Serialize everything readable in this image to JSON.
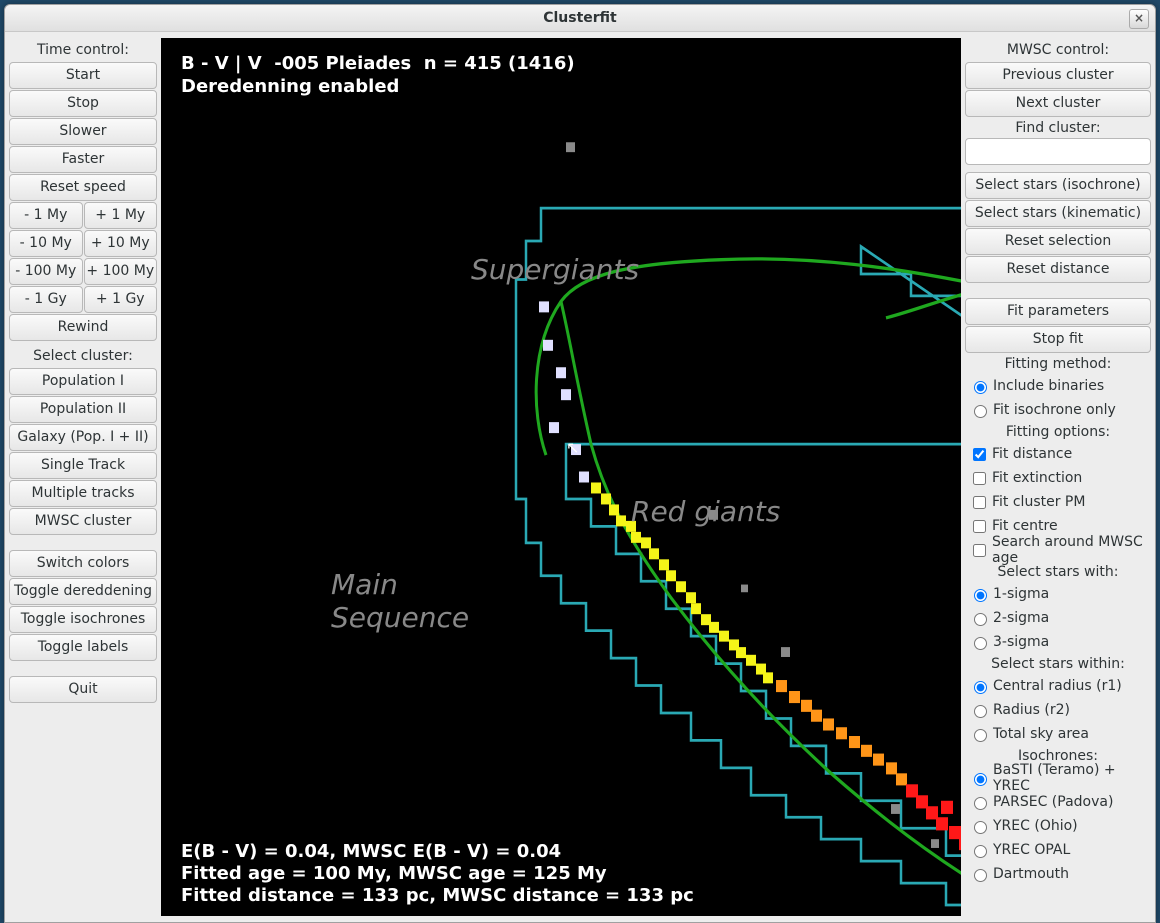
{
  "window": {
    "title": "Clusterfit"
  },
  "left": {
    "time_control_label": "Time control:",
    "start": "Start",
    "stop": "Stop",
    "slower": "Slower",
    "faster": "Faster",
    "reset_speed": "Reset speed",
    "minus_1my": "- 1 My",
    "plus_1my": "+ 1 My",
    "minus_10my": "- 10 My",
    "plus_10my": "+ 10 My",
    "minus_100my": "- 100 My",
    "plus_100my": "+ 100 My",
    "minus_1gy": "- 1 Gy",
    "plus_1gy": "+ 1 Gy",
    "rewind": "Rewind",
    "select_cluster_label": "Select cluster:",
    "pop1": "Population I",
    "pop2": "Population II",
    "galaxy": "Galaxy (Pop. I + II)",
    "single_track": "Single Track",
    "multiple_tracks": "Multiple tracks",
    "mwsc_cluster": "MWSC cluster",
    "switch_colors": "Switch colors",
    "toggle_dered": "Toggle dereddening",
    "toggle_iso": "Toggle isochrones",
    "toggle_labels": "Toggle labels",
    "quit": "Quit"
  },
  "plot": {
    "header_line1": "B - V | V  -005 Pleiades  n = 415 (1416)",
    "header_line2": "Deredenning enabled",
    "label_supergiants": "Supergiants",
    "label_redgiants": "Red giants",
    "label_mainseq": "Main\nSequence",
    "footer_line1": "E(B - V) = 0.04, MWSC E(B - V) = 0.04",
    "footer_line2": "Fitted age = 100 My, MWSC age = 125 My",
    "footer_line3": "Fitted distance = 133 pc, MWSC distance = 133 pc"
  },
  "right": {
    "mwsc_control_label": "MWSC control:",
    "prev_cluster": "Previous cluster",
    "next_cluster": "Next cluster",
    "find_cluster_label": "Find cluster:",
    "find_cluster_value": "",
    "select_iso": "Select stars (isochrone)",
    "select_kin": "Select stars (kinematic)",
    "reset_selection": "Reset selection",
    "reset_distance": "Reset distance",
    "fit_params": "Fit parameters",
    "stop_fit": "Stop fit",
    "fitting_method_label": "Fitting method:",
    "opt_include_binaries": "Include binaries",
    "opt_fit_iso_only": "Fit isochrone only",
    "fitting_options_label": "Fitting options:",
    "opt_fit_distance": "Fit distance",
    "opt_fit_extinction": "Fit extinction",
    "opt_fit_pm": "Fit cluster PM",
    "opt_fit_centre": "Fit centre",
    "opt_search_mwsc_age": "Search around MWSC age",
    "select_stars_with_label": "Select stars with:",
    "sigma1": "1-sigma",
    "sigma2": "2-sigma",
    "sigma3": "3-sigma",
    "select_stars_within_label": "Select stars within:",
    "central_radius": "Central radius (r1)",
    "radius": "Radius (r2)",
    "total_sky": "Total sky area",
    "isochrones_label": "Isochrones:",
    "iso_basti": "BaSTI (Teramo) + YREC",
    "iso_parsec": "PARSEC (Padova)",
    "iso_yrec": "YREC (Ohio)",
    "iso_yrec_opal": "YREC OPAL",
    "iso_dartmouth": "Dartmouth"
  }
}
